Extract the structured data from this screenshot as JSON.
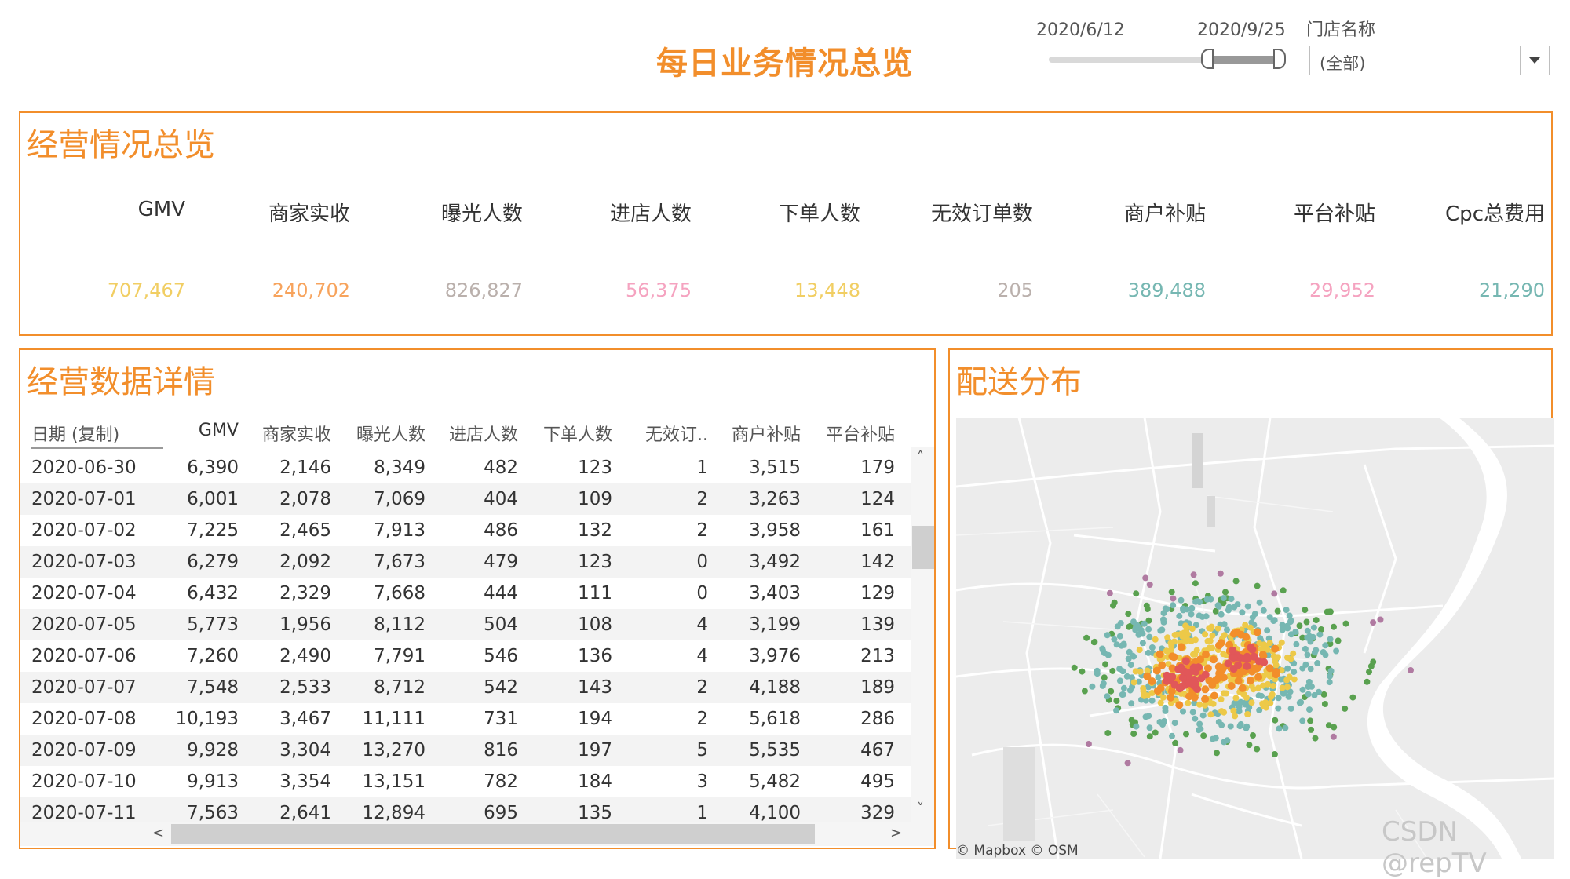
{
  "header": {
    "title": "每日业务情况总览",
    "date_start": "2020/6/12",
    "date_end": "2020/9/25",
    "date_range_start_fraction": 0.67,
    "date_range_end_fraction": 1.0,
    "store_filter_label": "门店名称",
    "store_filter_value": "(全部)"
  },
  "overview": {
    "title": "经营情况总览",
    "kpis": [
      {
        "label": "GMV",
        "value": "707,467",
        "color": "#f1ce63"
      },
      {
        "label": "商家实收",
        "value": "240,702",
        "color": "#f7a35c"
      },
      {
        "label": "曝光人数",
        "value": "826,827",
        "color": "#bab0ac"
      },
      {
        "label": "进店人数",
        "value": "56,375",
        "color": "#f5a3c0"
      },
      {
        "label": "下单人数",
        "value": "13,448",
        "color": "#f1ce63"
      },
      {
        "label": "无效订单数",
        "value": "205",
        "color": "#bab0ac"
      },
      {
        "label": "商户补贴",
        "value": "389,488",
        "color": "#76b7b2"
      },
      {
        "label": "平台补贴",
        "value": "29,952",
        "color": "#f5a3c0"
      },
      {
        "label": "Cpc总费用",
        "value": "21,290",
        "color": "#76b7b2"
      }
    ]
  },
  "details": {
    "title": "经营数据详情",
    "columns": [
      "日期 (复制)",
      "GMV",
      "商家实收",
      "曝光人数",
      "进店人数",
      "下单人数",
      "无效订..",
      "商户补贴",
      "平台补贴"
    ],
    "rows": [
      [
        "2020-06-30",
        "6,390",
        "2,146",
        "8,349",
        "482",
        "123",
        "1",
        "3,515",
        "179"
      ],
      [
        "2020-07-01",
        "6,001",
        "2,078",
        "7,069",
        "404",
        "109",
        "2",
        "3,263",
        "124"
      ],
      [
        "2020-07-02",
        "7,225",
        "2,465",
        "7,913",
        "486",
        "132",
        "2",
        "3,958",
        "161"
      ],
      [
        "2020-07-03",
        "6,279",
        "2,092",
        "7,673",
        "479",
        "123",
        "0",
        "3,492",
        "142"
      ],
      [
        "2020-07-04",
        "6,432",
        "2,329",
        "7,668",
        "444",
        "111",
        "0",
        "3,403",
        "129"
      ],
      [
        "2020-07-05",
        "5,773",
        "1,956",
        "8,112",
        "504",
        "108",
        "4",
        "3,199",
        "139"
      ],
      [
        "2020-07-06",
        "7,260",
        "2,490",
        "7,791",
        "546",
        "136",
        "4",
        "3,976",
        "213"
      ],
      [
        "2020-07-07",
        "7,548",
        "2,533",
        "8,712",
        "542",
        "143",
        "2",
        "4,188",
        "189"
      ],
      [
        "2020-07-08",
        "10,193",
        "3,467",
        "11,111",
        "731",
        "194",
        "2",
        "5,618",
        "286"
      ],
      [
        "2020-07-09",
        "9,928",
        "3,304",
        "13,270",
        "816",
        "197",
        "5",
        "5,535",
        "467"
      ],
      [
        "2020-07-10",
        "9,913",
        "3,354",
        "13,151",
        "782",
        "184",
        "3",
        "5,482",
        "495"
      ],
      [
        "2020-07-11",
        "7,563",
        "2,641",
        "12,894",
        "695",
        "135",
        "1",
        "4,100",
        "329"
      ]
    ],
    "scroll_up": "˄",
    "scroll_down": "˅",
    "scroll_left": "<",
    "scroll_right": ">"
  },
  "delivery": {
    "title": "配送分布",
    "attribution": "© Mapbox © OSM",
    "legend_colors": [
      "#e15759",
      "#f28e2b",
      "#edc948",
      "#76b7b2",
      "#59a14f",
      "#b07aa1"
    ]
  },
  "watermark": "CSDN @repTV"
}
